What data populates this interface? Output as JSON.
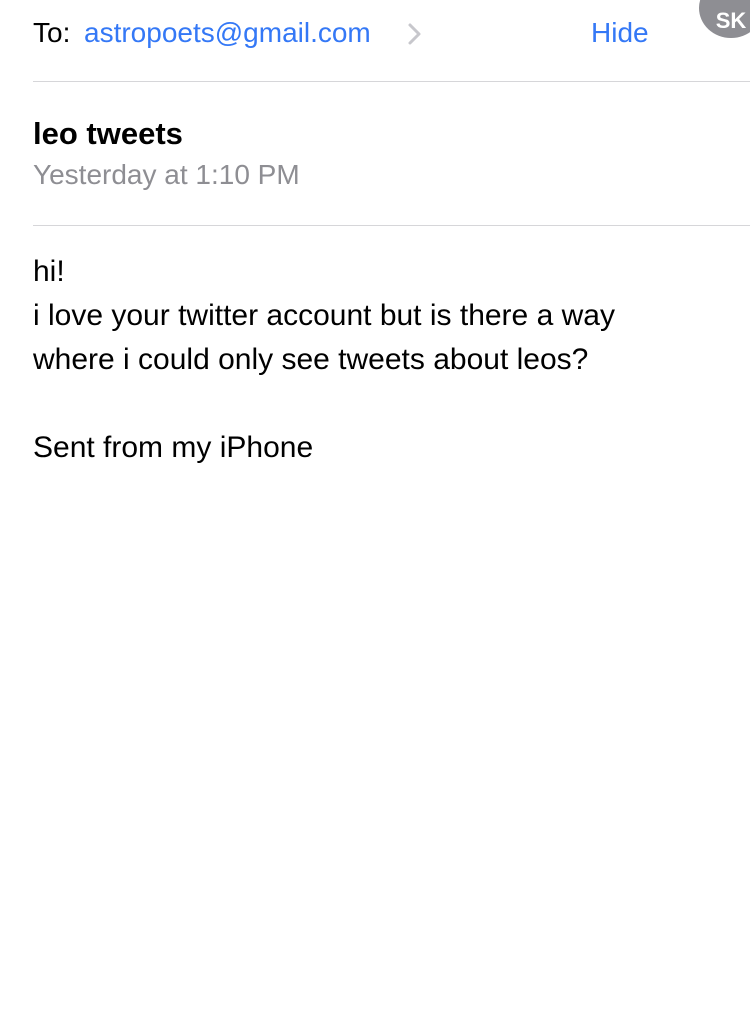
{
  "header": {
    "to_label": "To:",
    "recipient": "astropoets@gmail.com",
    "hide_label": "Hide",
    "avatar_initials": "SK"
  },
  "message": {
    "subject": "leo tweets",
    "timestamp": "Yesterday at 1:10 PM",
    "body_lines": [
      "hi!",
      "i love your twitter account but is there a way",
      "where i could only see tweets about leos?"
    ],
    "signature": "Sent from my iPhone"
  },
  "colors": {
    "link": "#3478f6",
    "secondary_text": "#8e8e93",
    "divider": "#d6d6d9",
    "avatar_bg": "#8e8e93"
  },
  "icons": {
    "chevron": "chevron-right-icon"
  }
}
